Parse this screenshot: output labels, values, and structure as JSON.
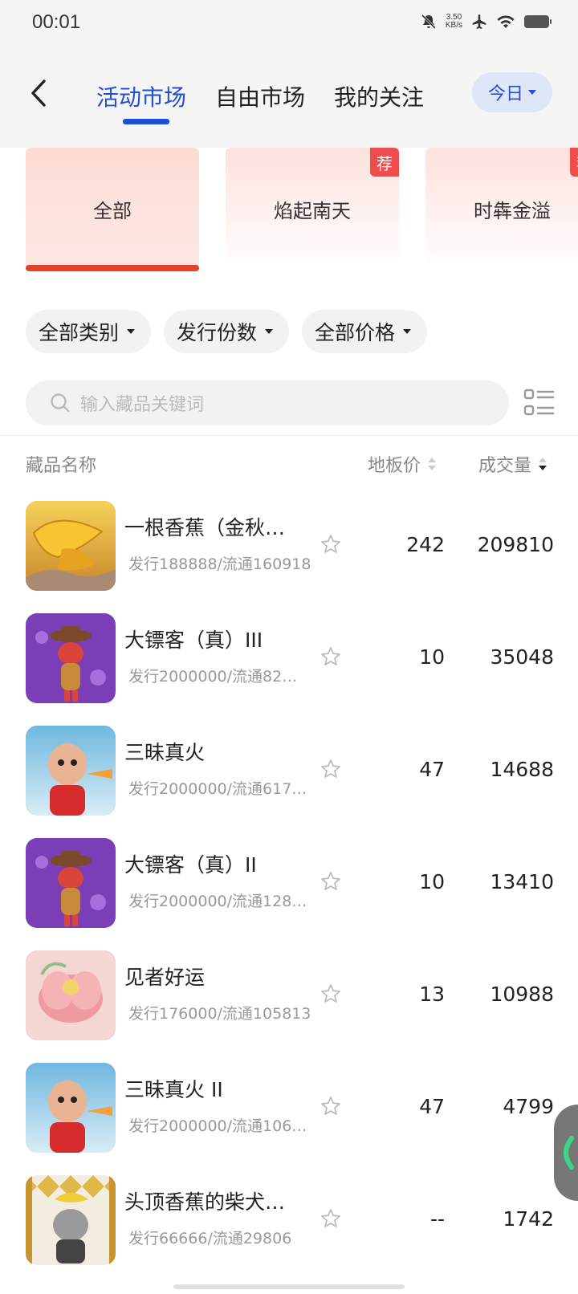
{
  "status": {
    "time": "00:01",
    "speed_value": "3.50",
    "speed_unit": "KB/s"
  },
  "header": {
    "tabs": [
      {
        "label": "活动市场"
      },
      {
        "label": "自由市场"
      },
      {
        "label": "我的关注"
      }
    ],
    "today_label": "今日"
  },
  "categories": [
    {
      "label": "全部"
    },
    {
      "label": "焰起南天",
      "badge": "荐"
    },
    {
      "label": "时犇金溢",
      "badge": "荐"
    }
  ],
  "filters": [
    {
      "label": "全部类别"
    },
    {
      "label": "发行份数"
    },
    {
      "label": "全部价格"
    }
  ],
  "search": {
    "placeholder": "输入藏品关键词"
  },
  "columns": {
    "name": "藏品名称",
    "floor_price": "地板价",
    "volume": "成交量"
  },
  "items": [
    {
      "name": "一根香蕉（金秋…",
      "sub": "发行188888/流通160918",
      "price": "242",
      "volume": "209810"
    },
    {
      "name": "大镖客（真）III",
      "sub": "发行2000000/流通82…",
      "price": "10",
      "volume": "35048"
    },
    {
      "name": "三昧真火",
      "sub": "发行2000000/流通617…",
      "price": "47",
      "volume": "14688"
    },
    {
      "name": "大镖客（真）II",
      "sub": "发行2000000/流通128…",
      "price": "10",
      "volume": "13410"
    },
    {
      "name": "见者好运",
      "sub": "发行176000/流通105813",
      "price": "13",
      "volume": "10988"
    },
    {
      "name": "三昧真火 II",
      "sub": "发行2000000/流通106…",
      "price": "47",
      "volume": "4799"
    },
    {
      "name": "头顶香蕉的柴犬…",
      "sub": "发行66666/流通29806",
      "price": "--",
      "volume": "1742"
    }
  ],
  "colors": {
    "accent": "#1f4fd9",
    "category_accent": "#e0442a",
    "badge": "#f04c4c"
  }
}
